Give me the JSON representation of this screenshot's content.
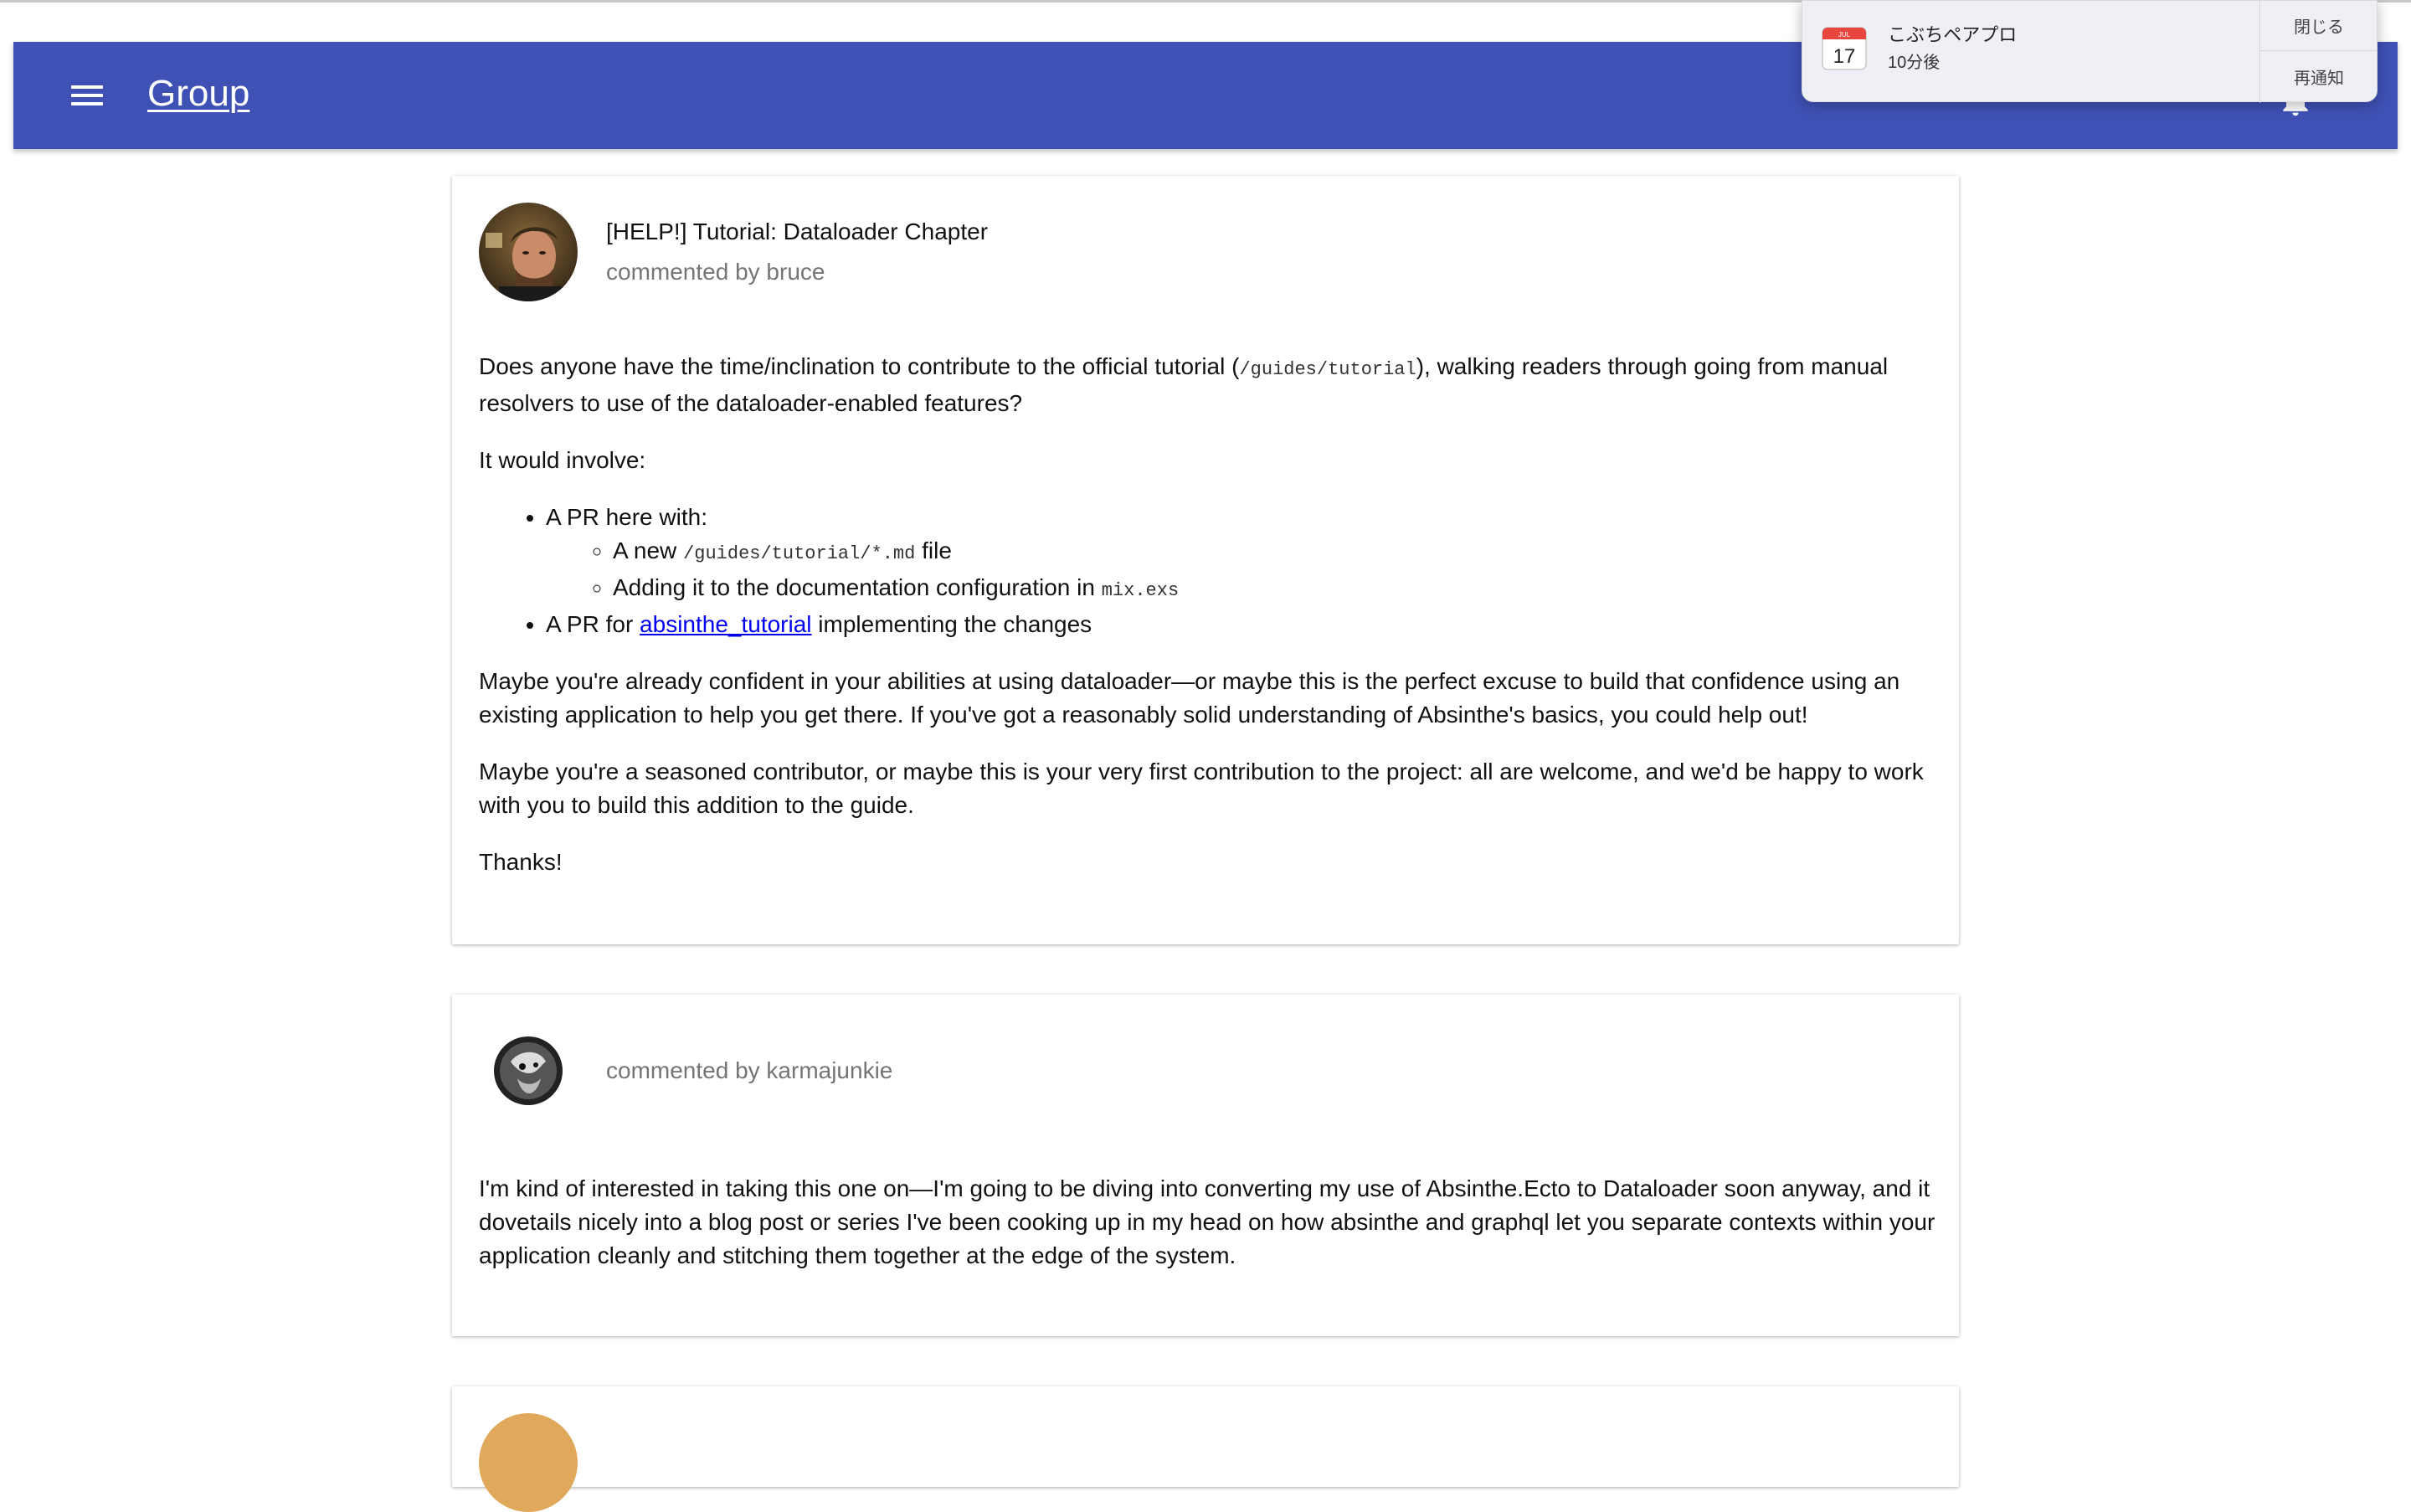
{
  "app_bar": {
    "title": "Group",
    "menu_icon": "hamburger-menu-icon",
    "bell_icon": "notifications-bell-icon",
    "color": "#3f51b5"
  },
  "notification": {
    "app_icon": "calendar-icon",
    "calendar_month": "JUL",
    "calendar_day": "17",
    "title": "こぶちペアプロ",
    "subtitle": "10分後",
    "close_label": "閉じる",
    "snooze_label": "再通知"
  },
  "posts": [
    {
      "title": "[HELP!] Tutorial: Dataloader Chapter",
      "byline": "commented by bruce",
      "p1_before": "Does anyone have the time/inclination to contribute to the official tutorial (",
      "p1_code": "/guides/tutorial",
      "p1_after": "), walking readers through going from manual resolvers to use of the dataloader-enabled features?",
      "p2": "It would involve:",
      "list1_label": "A PR here with:",
      "sub1_before": "A new ",
      "sub1_code": "/guides/tutorial/*.md",
      "sub1_after": " file",
      "sub2_before": "Adding it to the documentation configuration in ",
      "sub2_code": "mix.exs",
      "list2_before": "A PR for ",
      "list2_link": "absinthe_tutorial",
      "list2_after": " implementing the changes",
      "p3": "Maybe you're already confident in your abilities at using dataloader—or maybe this is the perfect excuse to build that confidence using an existing application to help you get there. If you've got a reasonably solid understanding of Absinthe's basics, you could help out!",
      "p4": "Maybe you're a seasoned contributor, or maybe this is your very first contribution to the project: all are welcome, and we'd be happy to work with you to build this addition to the guide.",
      "p5": "Thanks!"
    },
    {
      "byline": "commented by karmajunkie",
      "p1": "I'm kind of interested in taking this one on—I'm going to be diving into converting my use of Absinthe.Ecto to Dataloader soon anyway, and it dovetails nicely into a blog post or series I've been cooking up in my head on how absinthe and graphql let you separate contexts within your application cleanly and stitching them together at the edge of the system."
    }
  ]
}
